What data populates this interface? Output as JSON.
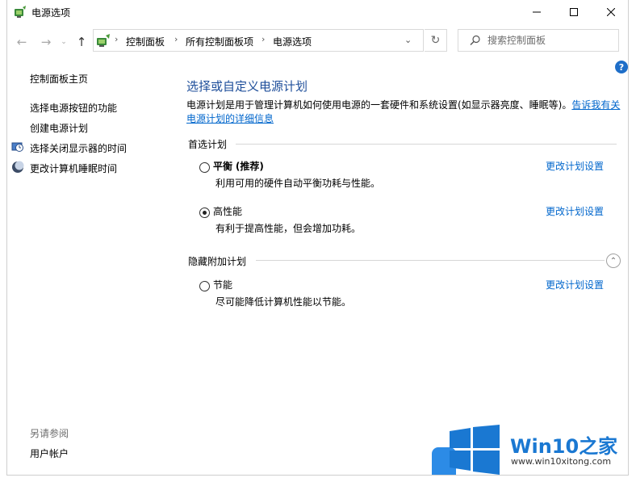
{
  "window": {
    "title": "电源选项"
  },
  "breadcrumb": [
    "控制面板",
    "所有控制面板项",
    "电源选项"
  ],
  "search": {
    "placeholder": "搜索控制面板"
  },
  "sidebar": {
    "home": "控制面板主页",
    "links": [
      "选择电源按钮的功能",
      "创建电源计划",
      "选择关闭显示器的时间",
      "更改计算机睡眠时间"
    ],
    "see_also_heading": "另请参阅",
    "see_also_links": [
      "用户帐户"
    ]
  },
  "main": {
    "title": "选择或自定义电源计划",
    "description": "电源计划是用于管理计算机如何使用电源的一套硬件和系统设置(如显示器亮度、睡眠等)。",
    "description_link": "告诉我有关电源计划的详细信息",
    "preferred_label": "首选计划",
    "hidden_label": "隐藏附加计划",
    "change_link": "更改计划设置",
    "plans": [
      {
        "name": "平衡",
        "tag": "(推荐)",
        "desc": "利用可用的硬件自动平衡功耗与性能。",
        "selected": false
      },
      {
        "name": "高性能",
        "tag": "",
        "desc": "有利于提高性能，但会增加功耗。",
        "selected": true
      },
      {
        "name": "节能",
        "tag": "",
        "desc": "尽可能降低计算机性能以节能。",
        "selected": false
      }
    ]
  },
  "watermark": {
    "brand_prefix": "Win10",
    "brand_suffix": "之家",
    "url": "www.win10xitong.com"
  },
  "colors": {
    "link": "#0066cc",
    "title": "#1e4e9a",
    "help": "#1e6ec8",
    "watermark": "#1a78d2"
  }
}
